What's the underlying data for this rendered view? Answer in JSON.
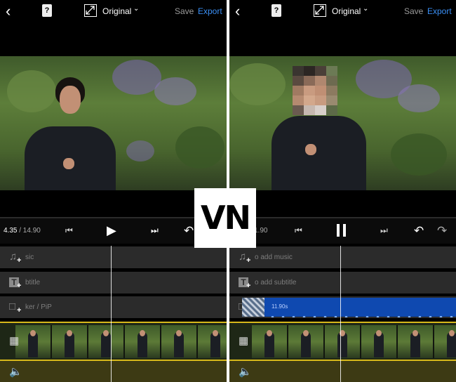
{
  "logo": {
    "text": "VN"
  },
  "before": {
    "topbar": {
      "back_icon": "back-chevron-icon",
      "book_label": "?",
      "ratio_label": "Original",
      "save_label": "Save",
      "export_label": "Export"
    },
    "playback": {
      "time_current": "4.35",
      "time_total": " / 14.90"
    },
    "tracks": {
      "music": "sic",
      "subtitle": "btitle",
      "sticker": "ker / PiP"
    }
  },
  "after": {
    "topbar": {
      "back_icon": "back-chevron-icon",
      "book_label": "?",
      "ratio_label": "Original",
      "save_label": "Save",
      "export_label": "Export"
    },
    "playback": {
      "time_total": "1.90"
    },
    "tracks": {
      "music": "o add music",
      "subtitle": "o add subtitle",
      "pip_duration": "11.90s"
    }
  },
  "colors": {
    "accent_blue": "#3a8ff5",
    "pip_clip": "#0f49b0",
    "timeline_border": "#d7b91b"
  }
}
